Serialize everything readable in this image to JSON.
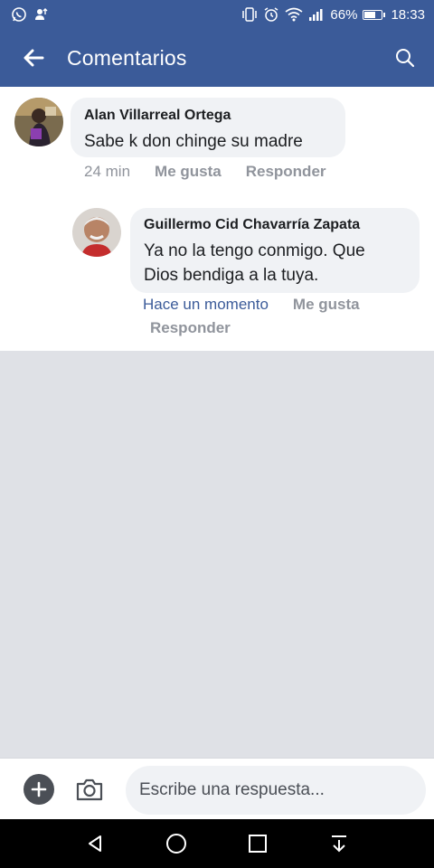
{
  "status_bar": {
    "left_icons": [
      "whatsapp-icon",
      "person-upload-icon"
    ],
    "right_icons": [
      "vibrate-icon",
      "alarm-icon",
      "wifi-icon",
      "signal-icon"
    ],
    "battery_percent": "66%",
    "battery_level": 0.66,
    "time": "18:33"
  },
  "app_bar": {
    "title": "Comentarios",
    "back_icon": "arrow-left-icon",
    "search_icon": "search-icon",
    "background": "#3b5b99"
  },
  "comments": [
    {
      "author": "Alan Villarreal Ortega",
      "text": "Sabe k don chinge su madre",
      "time": "24 min",
      "like_label": "Me gusta",
      "reply_label": "Responder"
    },
    {
      "author": "Guillermo Cid Chavarría Zapata",
      "text_line1": "Ya no la tengo conmigo. Que",
      "text_line2": "Dios bendiga a la tuya.",
      "time": "Hace un momento",
      "like_label": "Me gusta",
      "reply_label": "Responder"
    }
  ],
  "composer": {
    "placeholder": "Escribe una respuesta...",
    "add_icon": "plus-circle-icon",
    "camera_icon": "camera-icon"
  },
  "nav_bar": {
    "icons": [
      "back-triangle-icon",
      "home-circle-icon",
      "recents-square-icon",
      "notification-pull-icon"
    ]
  }
}
